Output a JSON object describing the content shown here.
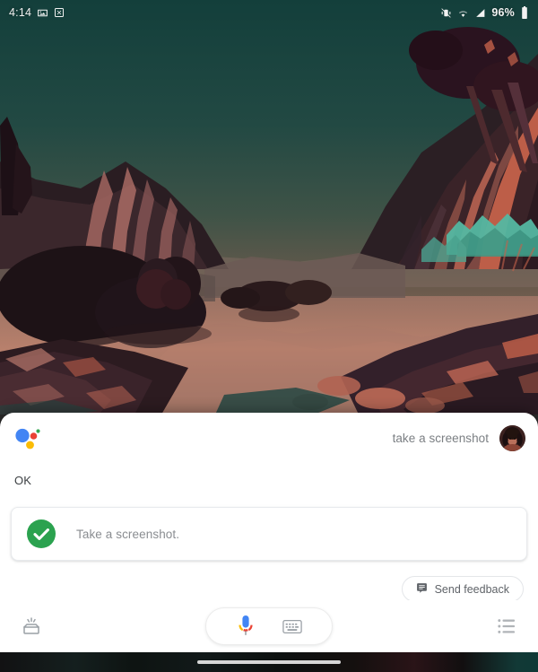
{
  "status_bar": {
    "clock": "4:14",
    "left_icons": [
      "image-icon",
      "screenshot-icon"
    ],
    "right_icons": [
      "vibrate-icon",
      "wifi-icon",
      "cellular-signal-icon"
    ],
    "battery_percent": "96%",
    "battery_icon": "battery-full-icon",
    "text_color": "#f2f2f2"
  },
  "wallpaper": {
    "name": "canyon-valley-illustration",
    "sky_top_color": "#14403c",
    "sky_bottom_color": "#95776a",
    "rock_accent_color": "#c4624a",
    "foliage_accent_color": "#5fc2ae"
  },
  "assistant": {
    "logo_icon": "google-assistant-dots-icon",
    "logo_colors": [
      "#4285f4",
      "#ea4335",
      "#fbbc05",
      "#34a853"
    ],
    "query_text": "take a screenshot",
    "avatar_icon": "user-avatar",
    "response_text": "OK",
    "result_card": {
      "status_icon": "check-circle-icon",
      "status_color": "#2ba24f",
      "label": "Take a screenshot."
    },
    "feedback_button": {
      "label": "Send feedback",
      "icon": "feedback-icon"
    },
    "toolbar": {
      "left_icon": "google-lens-explore-icon",
      "mic_icon": "google-microphone-icon",
      "keyboard_icon": "keyboard-icon",
      "right_icon": "snapshot-list-icon"
    }
  },
  "navigation_bar": {
    "gesture_pill": "home-gesture-pill",
    "background_color": "#0b0b0c"
  }
}
